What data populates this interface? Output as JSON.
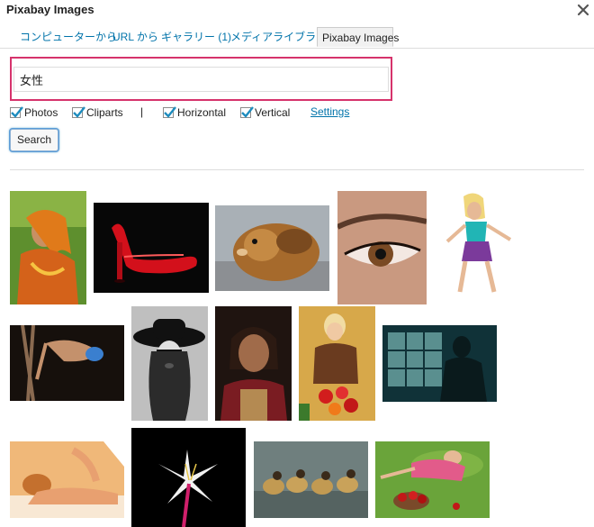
{
  "dialog": {
    "title": "Pixabay Images"
  },
  "tabs": [
    {
      "label": "コンピューターから"
    },
    {
      "label": "URL から"
    },
    {
      "label": "ギャラリー (1)"
    },
    {
      "label": "メディアライブラリ"
    },
    {
      "label": "Pixabay Images",
      "active": true
    }
  ],
  "search": {
    "value": "女性"
  },
  "options": {
    "photos": {
      "label": "Photos",
      "checked": true
    },
    "cliparts": {
      "label": "Cliparts",
      "checked": true
    },
    "separator": "|",
    "horizontal": {
      "label": "Horizontal",
      "checked": true
    },
    "vertical": {
      "label": "Vertical",
      "checked": true
    },
    "settings_label": "Settings"
  },
  "search_button": {
    "label": "Search"
  },
  "colors": {
    "accent_link": "#0073aa",
    "highlight_border": "#d6336c",
    "checkmark": "#1e8cbe"
  },
  "results": [
    {
      "subject": "woman-in-orange-scarf"
    },
    {
      "subject": "red-high-heel-shoe"
    },
    {
      "subject": "guinea-pig"
    },
    {
      "subject": "eye-closeup"
    },
    {
      "subject": "blonde-woman-kneeling"
    },
    {
      "subject": "aerial-silk-dancer"
    },
    {
      "subject": "woman-in-black-hat"
    },
    {
      "subject": "elderly-woman-portrait"
    },
    {
      "subject": "woman-with-flowers"
    },
    {
      "subject": "silhouette-by-window"
    },
    {
      "subject": "massage"
    },
    {
      "subject": "white-lily"
    },
    {
      "subject": "ducks"
    },
    {
      "subject": "woman-lying-in-grass-with-apples"
    }
  ]
}
